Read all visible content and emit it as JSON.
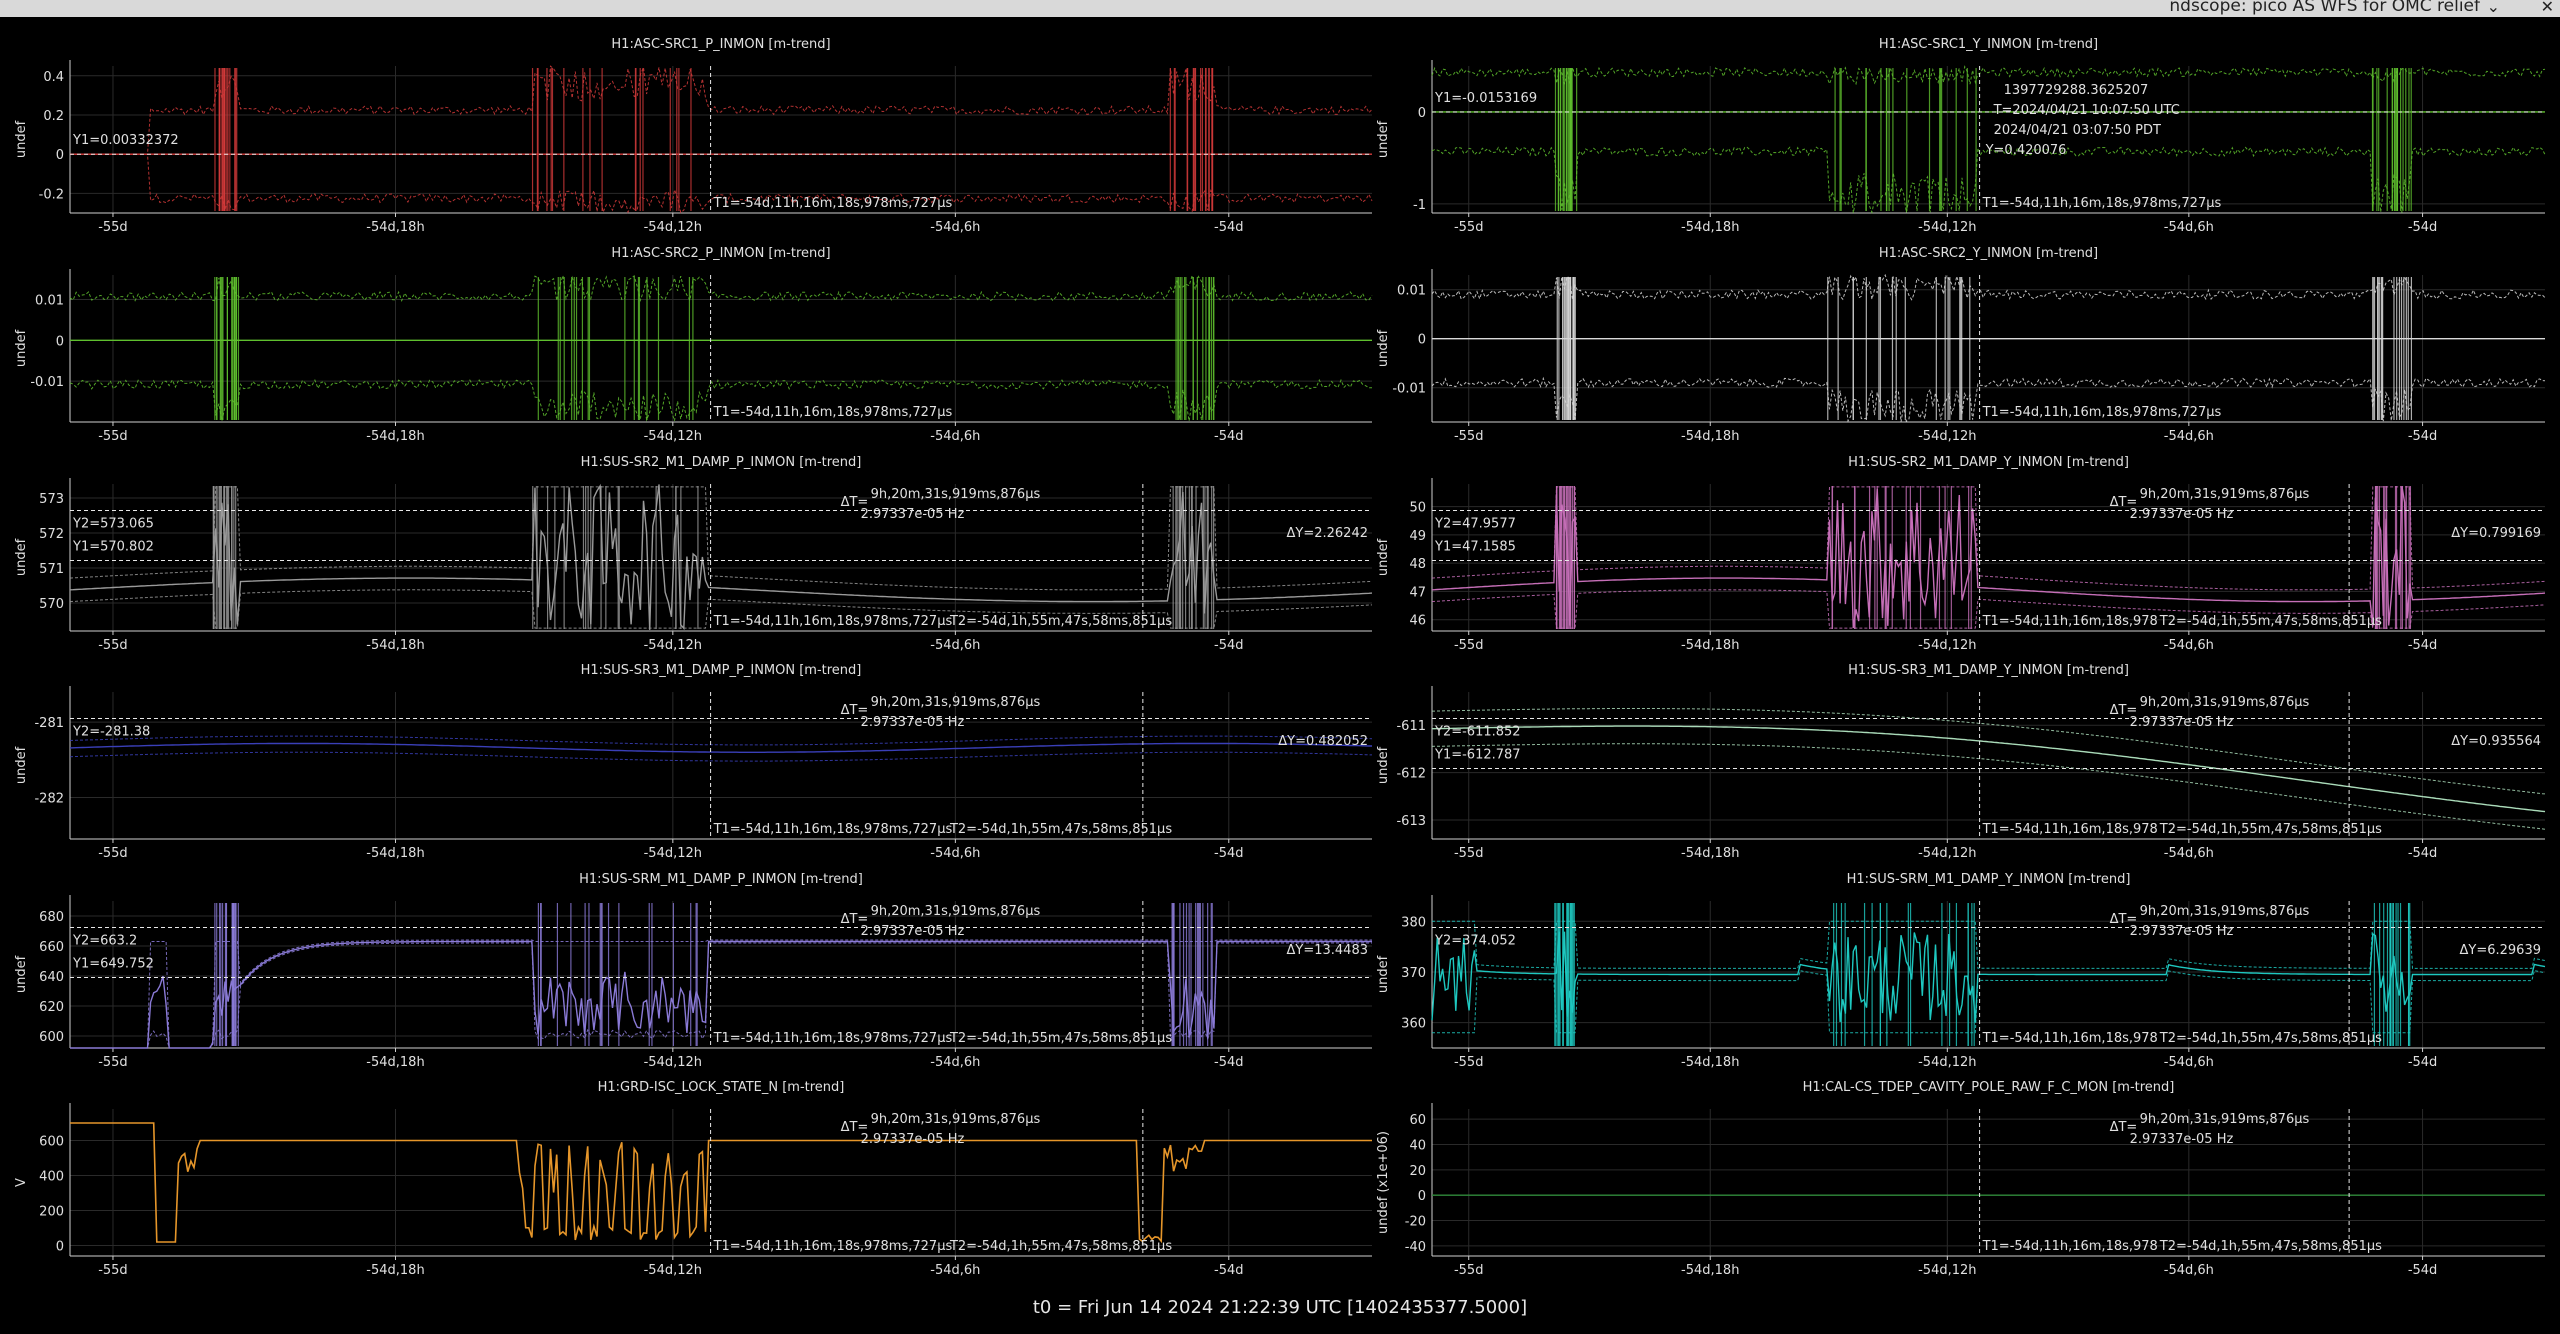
{
  "window": {
    "title": "ndscope: pico AS WFS for OMC relief",
    "minimize_icon": "chevron-down-icon",
    "close_icon": "close-icon"
  },
  "x_ticks": [
    "-55d",
    "-54d,18h",
    "-54d,12h",
    "-54d,6h",
    "-54d"
  ],
  "footer": "t0 = Fri Jun 14 2024 21:22:39 UTC [1402435377.5000]",
  "delta": {
    "dt": "ΔT=",
    "dt_val": "9h,20m,31s,919ms,876μs",
    "freq": "2.97337e-05 Hz"
  },
  "colors": {
    "background": "#000000",
    "grid": "#2a2a2a",
    "axis": "#cfcfcf",
    "red": "#d23a3a",
    "green": "#5fbf2e",
    "white": "#d9d9d9",
    "pink": "#c66fb8",
    "blue": "#3a3fb8",
    "mint": "#aadbb9",
    "purple": "#8a7ad6",
    "cyan": "#1ec8c0",
    "orange": "#e6962a",
    "darkgreen": "#2f8a3a"
  },
  "plots": [
    {
      "id": "p1",
      "title": "H1:ASC-SRC1_P_INMON [m-trend]",
      "ylabel": "undef",
      "ylim": [
        -0.3,
        0.45
      ],
      "yticks": [
        "0.4",
        "0.2",
        "0",
        "-0.2"
      ],
      "color": "#d23a3a",
      "kind": "burst",
      "cursors": {
        "t1": "T1=-54d,11h,16m,18s,978ms,727μs",
        "y1": "Y1=0.00332372"
      }
    },
    {
      "id": "p2",
      "title": "H1:ASC-SRC1_Y_INMON [m-trend]",
      "ylabel": "undef",
      "ylim": [
        -1.1,
        0.5
      ],
      "yticks": [
        "0",
        "-1"
      ],
      "color": "#5fbf2e",
      "kind": "burst",
      "cursors": {
        "t1": "T1=-54d,11h,16m,18s,978ms,727μs",
        "y1": "Y1=-0.0153169"
      },
      "tooltip": [
        "1397729288.3625207",
        "T=2024/04/21 10:07:50 UTC",
        "2024/04/21 03:07:50 PDT",
        "Y=0.420076"
      ]
    },
    {
      "id": "p3",
      "title": "H1:ASC-SRC2_P_INMON [m-trend]",
      "ylabel": "undef",
      "ylim": [
        -0.02,
        0.016
      ],
      "yticks": [
        "0.01",
        "0",
        "-0.01"
      ],
      "color": "#5fbf2e",
      "kind": "burst",
      "cursors": {
        "t1": "T1=-54d,11h,16m,18s,978ms,727μs"
      }
    },
    {
      "id": "p4",
      "title": "H1:ASC-SRC2_Y_INMON [m-trend]",
      "ylabel": "undef",
      "ylim": [
        -0.017,
        0.013
      ],
      "yticks": [
        "0.01",
        "0",
        "-0.01"
      ],
      "color": "#d9d9d9",
      "kind": "burst",
      "cursors": {
        "t1": "T1=-54d,11h,16m,18s,978ms,727μs"
      }
    },
    {
      "id": "p5",
      "title": "H1:SUS-SR2_M1_DAMP_P_INMON [m-trend]",
      "ylabel": "undef",
      "ylim": [
        569.2,
        573.4
      ],
      "yticks": [
        "573",
        "572",
        "571",
        "570"
      ],
      "color": "#9a9a9a",
      "kind": "level",
      "cursors": {
        "t1": "T1=-54d,11h,16m,18s,978ms,727μs",
        "t2": "T2=-54d,1h,55m,47s,58ms,851μs",
        "y1": "Y1=570.802",
        "y2": "Y2=573.065",
        "dy": "ΔY=2.26242"
      }
    },
    {
      "id": "p6",
      "title": "H1:SUS-SR2_M1_DAMP_Y_INMON [m-trend]",
      "ylabel": "undef",
      "ylim": [
        45.6,
        50.8
      ],
      "yticks": [
        "50",
        "49",
        "48",
        "47",
        "46"
      ],
      "color": "#c66fb8",
      "kind": "level",
      "cursors": {
        "t1": "T1=-54d,11h,16m,18s,978",
        "t2": "T2=-54d,1h,55m,47s,58ms,851μs",
        "y1": "Y1=47.1585",
        "y2": "Y2=47.9577",
        "dy": "ΔY=0.799169"
      }
    },
    {
      "id": "p7",
      "title": "H1:SUS-SR3_M1_DAMP_P_INMON [m-trend]",
      "ylabel": "undef",
      "ylim": [
        -282.55,
        -280.6
      ],
      "yticks": [
        "-281",
        "-282"
      ],
      "color": "#3a3fb8",
      "kind": "flat",
      "cursors": {
        "t1": "T1=-54d,11h,16m,18s,978ms,727μs",
        "t2": "T2=-54d,1h,55m,47s,58ms,851μs",
        "y2": "Y2=-281.38",
        "dy": "ΔY=0.482052"
      }
    },
    {
      "id": "p8",
      "title": "H1:SUS-SR3_M1_DAMP_Y_INMON [m-trend]",
      "ylabel": "undef",
      "ylim": [
        -613.4,
        -610.3
      ],
      "yticks": [
        "-611",
        "-612",
        "-613"
      ],
      "color": "#aadbb9",
      "kind": "drift",
      "cursors": {
        "t1": "T1=-54d,11h,16m,18s,978",
        "t2": "T2=-54d,1h,55m,47s,58ms,851μs",
        "y1": "Y1=-612.787",
        "y2": "Y2=-611.852",
        "dy": "ΔY=0.935564"
      }
    },
    {
      "id": "p9",
      "title": "H1:SUS-SRM_M1_DAMP_P_INMON [m-trend]",
      "ylabel": "undef",
      "ylim": [
        592,
        690
      ],
      "yticks": [
        "680",
        "660",
        "640",
        "620",
        "600"
      ],
      "color": "#8a7ad6",
      "kind": "drops",
      "cursors": {
        "t1": "T1=-54d,11h,16m,18s,978ms,727μs",
        "t2": "T2=-54d,1h,55m,47s,58ms,851μs",
        "y1": "Y1=649.752",
        "y2": "Y2=663.2",
        "dy": "ΔY=13.4483"
      }
    },
    {
      "id": "p10",
      "title": "H1:SUS-SRM_M1_DAMP_Y_INMON [m-trend]",
      "ylabel": "undef",
      "ylim": [
        355,
        384
      ],
      "yticks": [
        "380",
        "370",
        "360"
      ],
      "color": "#1ec8c0",
      "kind": "spikes",
      "cursors": {
        "t1": "T1=-54d,11h,16m,18s,978",
        "t2": "T2=-54d,1h,55m,47s,58ms,851μs",
        "y2": "Y2=374.052",
        "dy": "ΔY=6.29639"
      }
    },
    {
      "id": "p11",
      "title": "H1:GRD-ISC_LOCK_STATE_N [m-trend]",
      "ylabel": "V",
      "ylim": [
        -60,
        780
      ],
      "yticks": [
        "600",
        "400",
        "200",
        "0"
      ],
      "color": "#e6962a",
      "kind": "steps",
      "cursors": {
        "t1": "T1=-54d,11h,16m,18s,978ms,727μs",
        "t2": "T2=-54d,1h,55m,47s,58ms,851μs"
      }
    },
    {
      "id": "p12",
      "title": "H1:CAL-CS_TDEP_CAVITY_POLE_RAW_F_C_MON [m-trend]",
      "ylabel": "undef (x1e+06)",
      "ylim": [
        -48,
        68
      ],
      "yticks": [
        "60",
        "40",
        "20",
        "0",
        "-20",
        "-40"
      ],
      "color": "#2f8a3a",
      "kind": "sparse",
      "cursors": {
        "t1": "T1=-54d,11h,16m,18s,978",
        "t2": "T2=-54d,1h,55m,47s,58ms,851μs"
      }
    }
  ]
}
